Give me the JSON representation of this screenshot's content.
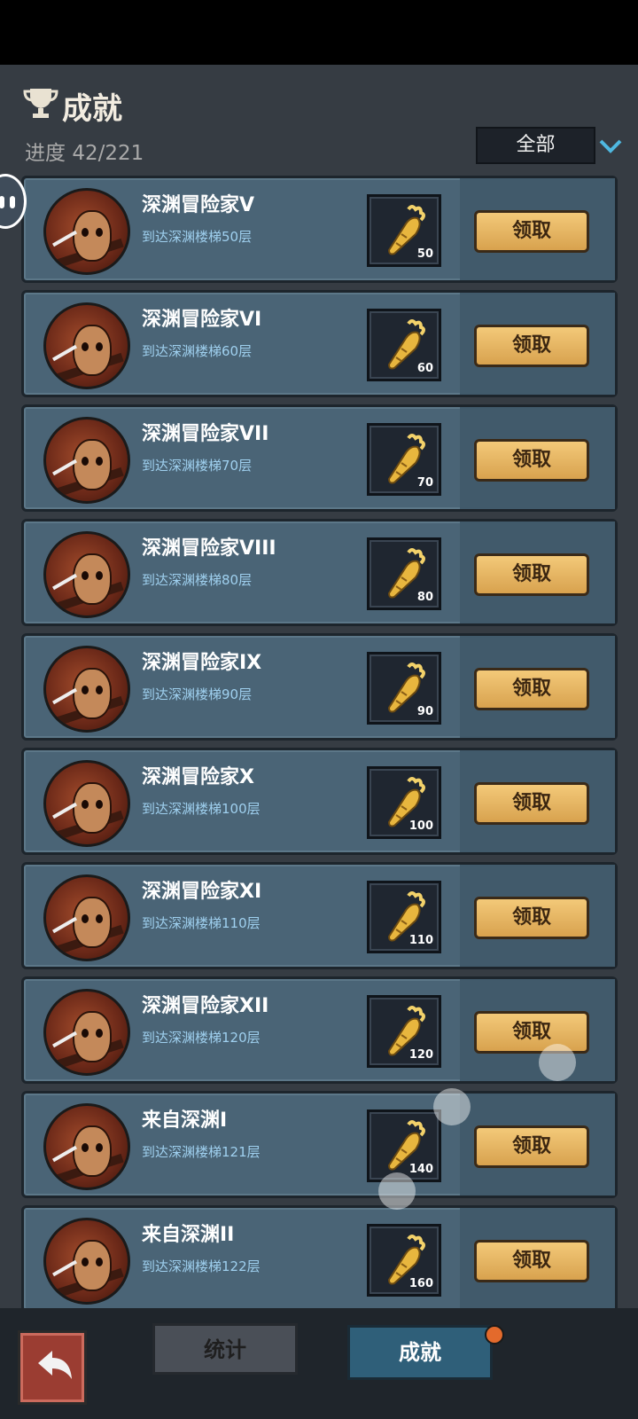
{
  "header": {
    "title": "成就",
    "progress_label": "进度",
    "progress_value": "42/221"
  },
  "filter": {
    "selected": "全部"
  },
  "achievements": [
    {
      "title": "深渊冒险家V",
      "desc": "到达深渊楼梯50层",
      "reward": "50",
      "button": "领取"
    },
    {
      "title": "深渊冒险家VI",
      "desc": "到达深渊楼梯60层",
      "reward": "60",
      "button": "领取"
    },
    {
      "title": "深渊冒险家VII",
      "desc": "到达深渊楼梯70层",
      "reward": "70",
      "button": "领取"
    },
    {
      "title": "深渊冒险家VIII",
      "desc": "到达深渊楼梯80层",
      "reward": "80",
      "button": "领取"
    },
    {
      "title": "深渊冒险家IX",
      "desc": "到达深渊楼梯90层",
      "reward": "90",
      "button": "领取"
    },
    {
      "title": "深渊冒险家X",
      "desc": "到达深渊楼梯100层",
      "reward": "100",
      "button": "领取"
    },
    {
      "title": "深渊冒险家XI",
      "desc": "到达深渊楼梯110层",
      "reward": "110",
      "button": "领取"
    },
    {
      "title": "深渊冒险家XII",
      "desc": "到达深渊楼梯120层",
      "reward": "120",
      "button": "领取"
    },
    {
      "title": "来自深渊I",
      "desc": "到达深渊楼梯121层",
      "reward": "140",
      "button": "领取"
    },
    {
      "title": "来自深渊II",
      "desc": "到达深渊楼梯122层",
      "reward": "160",
      "button": "领取"
    }
  ],
  "tabs": {
    "stats": "统计",
    "achievements": "成就"
  },
  "icons": {
    "header": "trophy-icon",
    "reward": "carrot-icon",
    "back": "return-arrow-icon"
  }
}
